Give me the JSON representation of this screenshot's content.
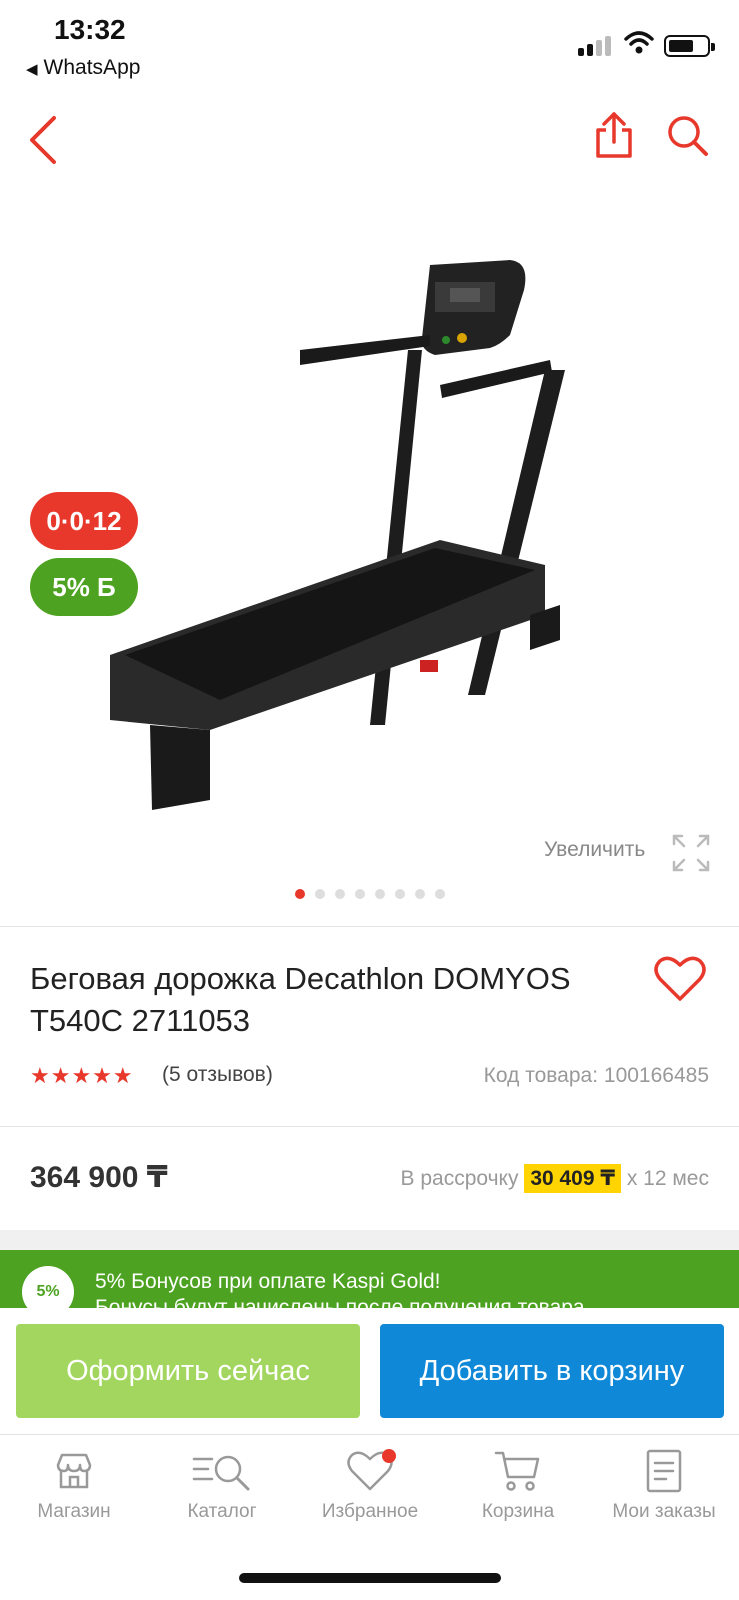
{
  "status_bar": {
    "time": "13:32",
    "back_app": "WhatsApp"
  },
  "gallery": {
    "installment_badge": "0·0·12",
    "bonus_badge": "5% Б",
    "zoom_label": "Увеличить",
    "dots_count": 8,
    "active_dot": 0
  },
  "product": {
    "title": "Беговая дорожка Decathlon DOMYOS T540C 2711053",
    "rating": 5,
    "reviews": "(5 отзывов)",
    "sku_label": "Код товара: 100166485",
    "price": "364 900 ₸",
    "installment_prefix": "В рассрочку",
    "installment_amount": "30 409 ₸",
    "installment_suffix": "х 12 мес"
  },
  "promo": {
    "circle": "5%",
    "line1": "5% Бонусов при оплате Kaspi Gold!",
    "line2": "Бонусы будут начислены после получения товара"
  },
  "actions": {
    "buy_now": "Оформить сейчас",
    "add_to_cart": "Добавить в корзину"
  },
  "tabbar": {
    "items": [
      {
        "label": "Магазин",
        "icon": "store-icon"
      },
      {
        "label": "Каталог",
        "icon": "catalog-icon"
      },
      {
        "label": "Избранное",
        "icon": "heart-icon",
        "notification": true
      },
      {
        "label": "Корзина",
        "icon": "cart-icon"
      },
      {
        "label": "Мои заказы",
        "icon": "orders-icon"
      }
    ]
  },
  "colors": {
    "red": "#e8382b",
    "green": "#4da321",
    "light_green": "#a2d65f",
    "blue": "#0f88d8",
    "yellow": "#ffd400"
  }
}
